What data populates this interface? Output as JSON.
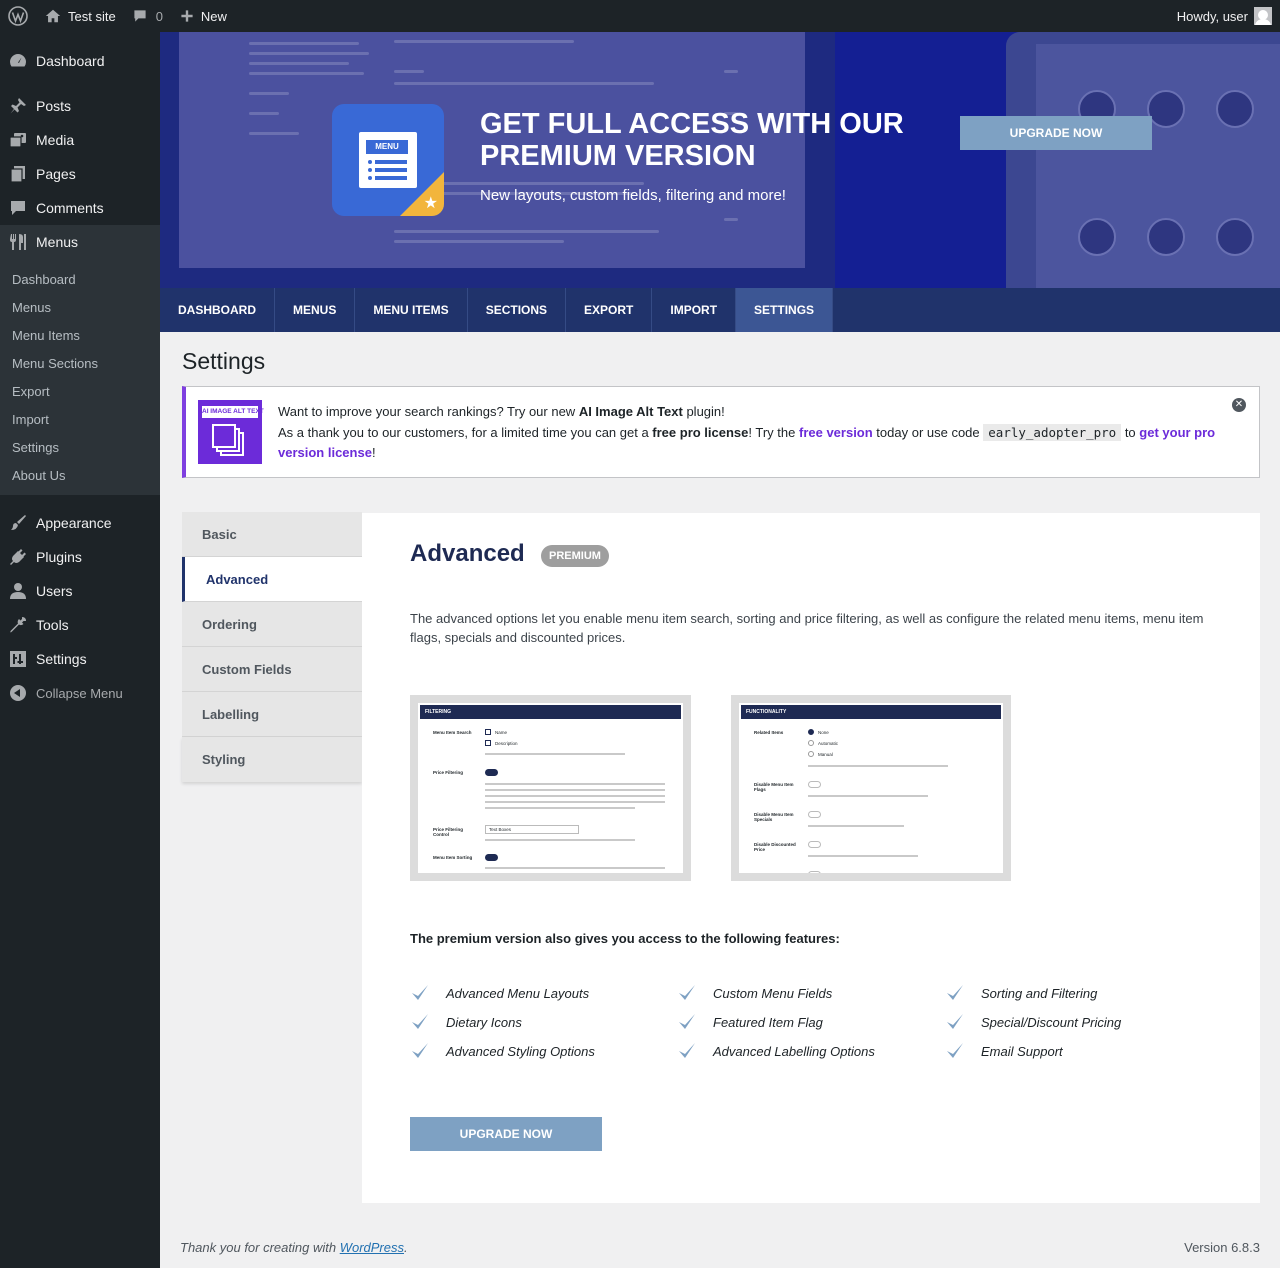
{
  "admin_bar": {
    "site_name": "Test site",
    "comments_count": "0",
    "new_label": "New",
    "greeting": "Howdy, user"
  },
  "sidebar": {
    "top_items": [
      {
        "label": "Dashboard",
        "icon": "dashboard-icon"
      },
      {
        "label": "Posts",
        "icon": "pushpin-icon"
      },
      {
        "label": "Media",
        "icon": "media-icon"
      },
      {
        "label": "Pages",
        "icon": "pages-icon"
      },
      {
        "label": "Comments",
        "icon": "comment-icon"
      },
      {
        "label": "Menus",
        "icon": "fork-knife-icon"
      }
    ],
    "submenu": [
      "Dashboard",
      "Menus",
      "Menu Items",
      "Menu Sections",
      "Export",
      "Import",
      "Settings",
      "About Us"
    ],
    "bottom_items": [
      {
        "label": "Appearance",
        "icon": "paintbrush-icon"
      },
      {
        "label": "Plugins",
        "icon": "plug-icon"
      },
      {
        "label": "Users",
        "icon": "user-icon"
      },
      {
        "label": "Tools",
        "icon": "wrench-icon"
      },
      {
        "label": "Settings",
        "icon": "sliders-icon"
      }
    ],
    "collapse_label": "Collapse Menu"
  },
  "banner": {
    "icon_label": "MENU",
    "title": "GET FULL ACCESS WITH OUR PREMIUM VERSION",
    "subtitle": "New layouts, custom fields, filtering and more!",
    "button": "UPGRADE NOW"
  },
  "tabs": [
    "DASHBOARD",
    "MENUS",
    "MENU ITEMS",
    "SECTIONS",
    "EXPORT",
    "IMPORT",
    "SETTINGS"
  ],
  "active_tab": "SETTINGS",
  "page_title": "Settings",
  "notice": {
    "logo_label": "AI IMAGE ALT TEXT",
    "line1_pre": "Want to improve your search rankings? Try our new ",
    "line1_bold": "AI Image Alt Text",
    "line1_post": " plugin!",
    "line2_pre": "As a thank you to our customers, for a limited time you can get a ",
    "line2_bold": "free pro license",
    "line2_mid": "! Try the ",
    "line2_link1": "free version",
    "line2_mid2": " today or use code ",
    "code": "early_adopter_pro",
    "line2_mid3": " to ",
    "line2_link2": "get your pro version license",
    "line2_end": "!"
  },
  "settings_sections": [
    "Basic",
    "Advanced",
    "Ordering",
    "Custom Fields",
    "Labelling",
    "Styling"
  ],
  "active_section": "Advanced",
  "panel": {
    "title": "Advanced",
    "badge": "PREMIUM",
    "description": "The advanced options let you enable menu item search, sorting and price filtering, as well as configure the related menu items, menu item flags, specials and discounted prices.",
    "screenshot1": {
      "header": "FILTERING",
      "labels": [
        "Menu Item Search",
        "Price Filtering",
        "Price Filtering Control",
        "Menu Item Sorting"
      ],
      "options": [
        "Name",
        "Description"
      ],
      "select_value": "Text Boxes"
    },
    "screenshot2": {
      "header": "FUNCTIONALITY",
      "labels": [
        "Related Items",
        "Disable Menu Item Flags",
        "Disable Menu Item Specials",
        "Disable Discounted Price"
      ],
      "options": [
        "None",
        "Automatic",
        "Manual"
      ]
    },
    "features_title": "The premium version also gives you access to the following features:",
    "features": [
      [
        "Advanced Menu Layouts",
        "Dietary Icons",
        "Advanced Styling Options"
      ],
      [
        "Custom Menu Fields",
        "Featured Item Flag",
        "Advanced Labelling Options"
      ],
      [
        "Sorting and Filtering",
        "Special/Discount Pricing",
        "Email Support"
      ]
    ],
    "button": "UPGRADE NOW"
  },
  "footer": {
    "thanks_pre": "Thank you for creating with ",
    "thanks_link": "WordPress",
    "thanks_post": ".",
    "version": "Version 6.8.3"
  },
  "colors": {
    "admin_dark": "#1d2327",
    "tab_nav": "#20336b",
    "banner_blue": "#1e2a80",
    "upgrade_button": "#7ea1c3",
    "notice_accent": "#7f3fe0"
  }
}
